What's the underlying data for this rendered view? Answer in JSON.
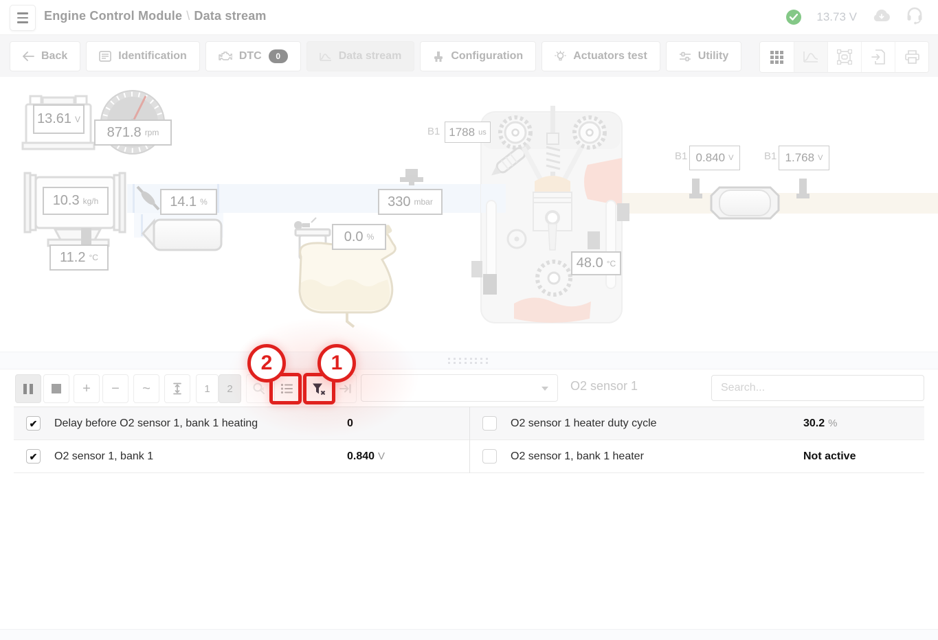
{
  "header": {
    "title_module": "Engine Control Module",
    "title_separator": "\\",
    "title_page": "Data stream",
    "battery_voltage": "13.73 V"
  },
  "tabs": {
    "back": "Back",
    "identification": "Identification",
    "dtc": "DTC",
    "dtc_badge": "0",
    "data_stream": "Data stream",
    "configuration": "Configuration",
    "actuators_test": "Actuators test",
    "utility": "Utility"
  },
  "diagram": {
    "gauges": {
      "battery": {
        "value": "13.61",
        "unit": "V"
      },
      "rpm": {
        "value": "871.8",
        "unit": "rpm"
      },
      "maf": {
        "value": "10.3",
        "unit": "kg/h"
      },
      "intake_temp": {
        "value": "11.2",
        "unit": "°C"
      },
      "throttle": {
        "value": "14.1",
        "unit": "%"
      },
      "map": {
        "value": "330",
        "unit": "mbar"
      },
      "purge": {
        "value": "0.0",
        "unit": "%"
      },
      "injection": {
        "bank": "B1",
        "value": "1788",
        "unit": "us"
      },
      "coolant": {
        "value": "48.0",
        "unit": "°C"
      },
      "o2_upstream": {
        "bank": "B1",
        "value": "0.840",
        "unit": "V"
      },
      "o2_downstream": {
        "bank": "B1",
        "value": "1.768",
        "unit": "V"
      }
    }
  },
  "stream_toolbar": {
    "glyphs": {
      "plus": "+",
      "minus": "−",
      "wave": "~",
      "one": "1",
      "two": "2"
    },
    "series_label": "O2 sensor 1",
    "search_placeholder": "Search...",
    "combo_selected": ""
  },
  "table": {
    "left": [
      {
        "checked": true,
        "label": "Delay before O2 sensor 1, bank 1 heating",
        "value": "0",
        "unit": ""
      },
      {
        "checked": true,
        "label": "O2 sensor 1, bank 1",
        "value": "0.840",
        "unit": "V"
      }
    ],
    "right": [
      {
        "checked": false,
        "label": "O2 sensor 1 heater duty cycle",
        "value": "30.2",
        "unit": "%"
      },
      {
        "checked": false,
        "label": "O2 sensor 1, bank 1 heater",
        "value": "Not active",
        "unit": ""
      }
    ]
  },
  "annotations": {
    "step1": "1",
    "step2": "2"
  },
  "colors": {
    "annotation_red": "#e0211e",
    "status_green": "#84c887",
    "intake_blue": "#e9f1fb",
    "exhaust_beige": "#f4ecdc"
  }
}
